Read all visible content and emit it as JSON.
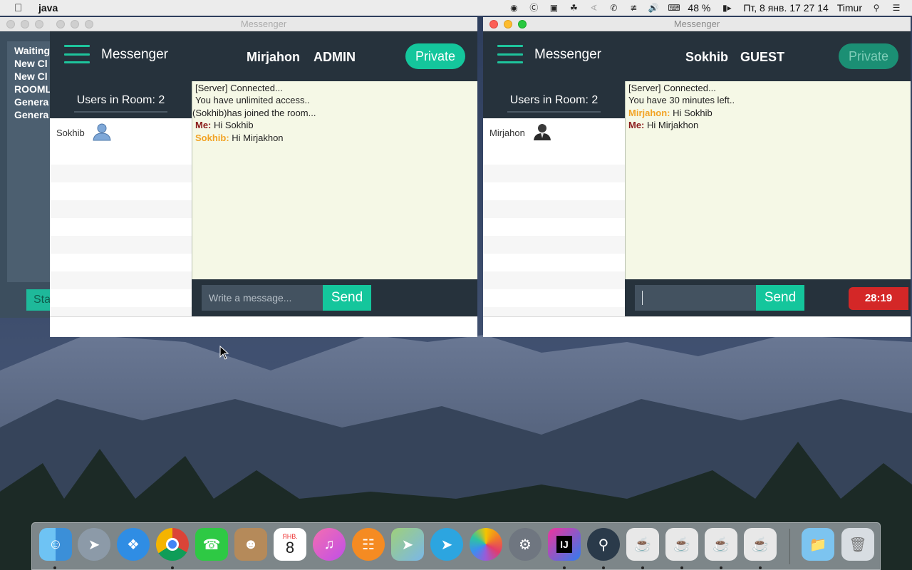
{
  "menubar": {
    "app_name": "java",
    "battery": "48 %",
    "datetime": "Пт, 8 янв.  17 27 14",
    "user": "Timur"
  },
  "background_window": {
    "items": [
      "Waiting",
      "New Cl",
      "New Cl",
      "ROOML",
      "Genera",
      "Genera"
    ],
    "start_label": "Sta"
  },
  "windows": [
    {
      "title": "Messenger",
      "brand": "Messenger",
      "username": "Mirjahon",
      "role": "ADMIN",
      "private_label": "Private",
      "users_in_room": "Users in Room: 2",
      "users": [
        {
          "name": "Sokhib",
          "icon": "user-blue-icon"
        }
      ],
      "messages": [
        {
          "prefix": "",
          "text": "[Server] Connected..."
        },
        {
          "prefix": "",
          "text": "You have unlimited access.."
        },
        {
          "prefix": "",
          "text": "(Sokhib)has joined the room..."
        },
        {
          "prefix": "Me:",
          "text": " Hi Sokhib",
          "kind": "me"
        },
        {
          "prefix": "Sokhib:",
          "text": " Hi Mirjakhon",
          "kind": "other"
        }
      ],
      "input_placeholder": "Write a message...",
      "send_label": "Send"
    },
    {
      "title": "Messenger",
      "brand": "Messenger",
      "username": "Sokhib",
      "role": "GUEST",
      "private_label": "Private",
      "users_in_room": "Users in Room: 2",
      "users": [
        {
          "name": "Mirjahon",
          "icon": "user-dark-icon"
        }
      ],
      "messages": [
        {
          "prefix": "",
          "text": "[Server] Connected..."
        },
        {
          "prefix": "",
          "text": "You have 30 minutes left.."
        },
        {
          "prefix": "Mirjahon:",
          "text": " Hi Sokhib",
          "kind": "other"
        },
        {
          "prefix": "Me:",
          "text": " Hi Mirjakhon",
          "kind": "me"
        }
      ],
      "input_placeholder": "",
      "send_label": "Send",
      "timer": "28:19"
    }
  ],
  "dock": {
    "items": [
      "finder-icon",
      "launchpad-icon",
      "safari-icon",
      "chrome-icon",
      "facetime-icon",
      "contacts-icon",
      "calendar-icon",
      "itunes-icon",
      "ibooks-icon",
      "maps-icon",
      "telegram-icon",
      "photos-icon",
      "system-preferences-icon",
      "intellij-icon",
      "quicktime-icon",
      "java-icon",
      "java-icon",
      "java-icon",
      "java-icon",
      "downloads-folder-icon",
      "trash-icon"
    ],
    "calendar_month": "ЯНВ.",
    "calendar_day": "8",
    "intellij_label": "IJ"
  },
  "colors": {
    "accent": "#14c69c",
    "header_bg": "#26323c",
    "chat_bg": "#f5f8e6",
    "me_color": "#8b1a1a",
    "other_color": "#f2a325",
    "timer_bg": "#d42727"
  }
}
